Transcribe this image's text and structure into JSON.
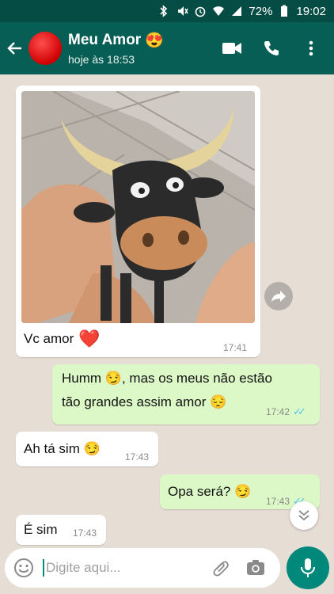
{
  "status_bar": {
    "battery": "72%",
    "time": "19:02"
  },
  "header": {
    "contact_name": "Meu Amor",
    "contact_emoji": "😍",
    "last_seen": "hoje às 18:53"
  },
  "messages": [
    {
      "type": "image",
      "direction": "incoming",
      "caption": "Vc amor",
      "emoji": "❤️",
      "time": "17:41"
    },
    {
      "direction": "outgoing",
      "line1": "Humm",
      "emoji1": "😏",
      "line1b": ", mas os meus não estão",
      "line2": "tão grandes assim amor",
      "emoji2": "😔",
      "time": "17:42"
    },
    {
      "direction": "incoming",
      "text": "Ah tá sim",
      "emoji": "😏",
      "time": "17:43"
    },
    {
      "direction": "outgoing",
      "text": "Opa será?",
      "emoji": "😏",
      "time": "17:43"
    },
    {
      "direction": "incoming",
      "text": "É sim",
      "time": "17:43"
    }
  ],
  "composer": {
    "placeholder": "Digite aqui..."
  },
  "colors": {
    "header": "#075e54",
    "status_bar": "#054d44",
    "outgoing_bubble": "#dcf8c6",
    "read_ticks": "#4fc3f7",
    "mic_button": "#00897b"
  },
  "icons": [
    "back-arrow-icon",
    "video-call-icon",
    "phone-icon",
    "more-vert-icon",
    "forward-icon",
    "chevron-down-icon",
    "emoji-icon",
    "attach-icon",
    "camera-icon",
    "mic-icon"
  ]
}
